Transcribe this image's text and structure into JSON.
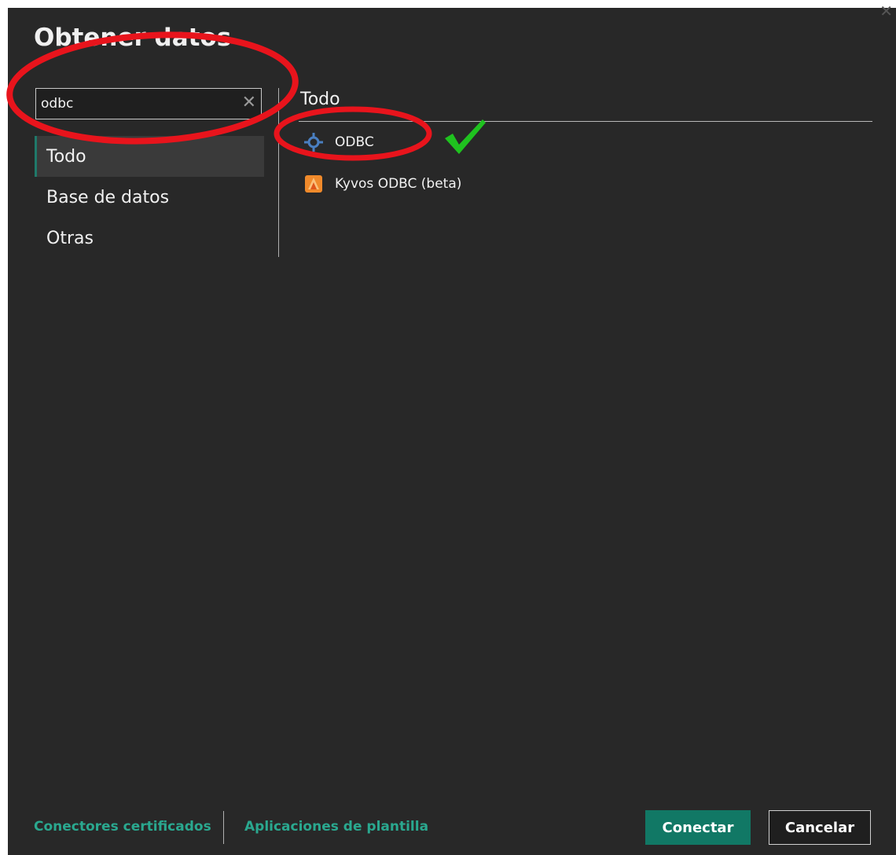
{
  "dialog": {
    "title": "Obtener datos",
    "close_icon": "close-icon"
  },
  "search": {
    "value": "odbc",
    "clear_icon": "close-icon"
  },
  "categories": [
    {
      "label": "Todo",
      "active": true
    },
    {
      "label": "Base de datos",
      "active": false
    },
    {
      "label": "Otras",
      "active": false
    }
  ],
  "results": {
    "header": "Todo",
    "items": [
      {
        "label": "ODBC",
        "icon": "odbc-connector-icon"
      },
      {
        "label": "Kyvos ODBC (beta)",
        "icon": "kyvos-logo-icon"
      }
    ]
  },
  "annotations": {
    "highlight_color": "#e8141c",
    "checkmark_color": "#1fc21f"
  },
  "footer": {
    "certified_connectors": "Conectores certificados",
    "template_apps": "Aplicaciones de plantilla",
    "connect_label": "Conectar",
    "cancel_label": "Cancelar",
    "accent_color": "#117865"
  }
}
